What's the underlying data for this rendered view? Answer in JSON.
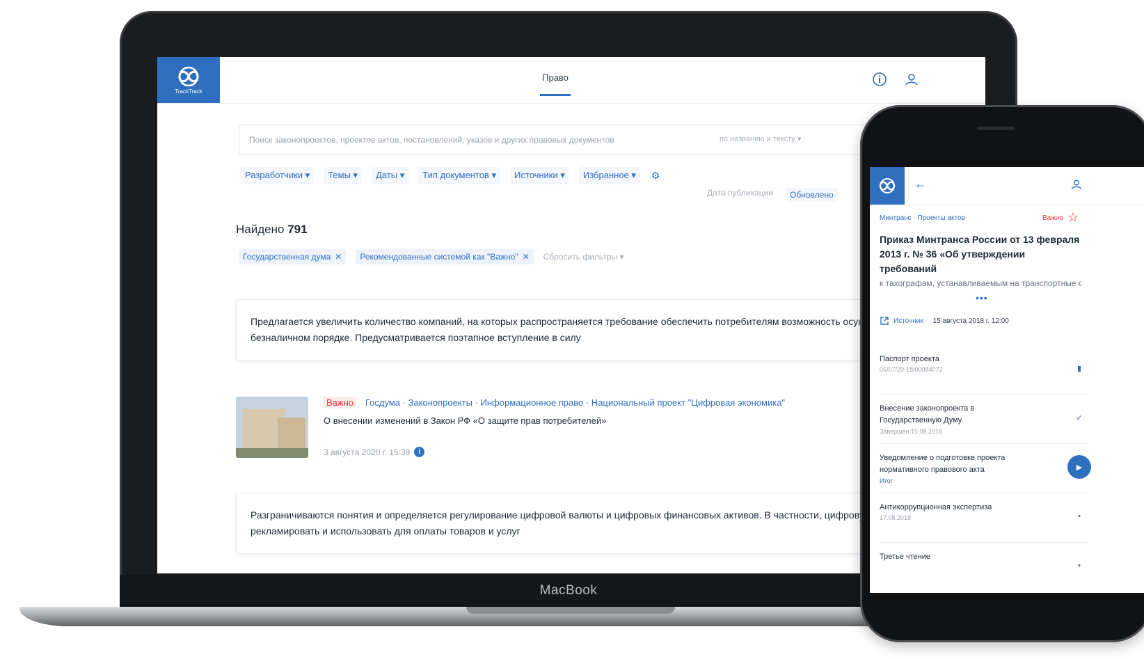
{
  "laptop": {
    "brand": "MacBook"
  },
  "app": {
    "logo_text": "TrackTrack",
    "nav_tab": "Право",
    "search": {
      "placeholder": "Поиск законопроектов, проектов актов, постановлений, указов и других правовых документов",
      "mode": "по названию и тексту ▾"
    },
    "filters": [
      "Разработчики ▾",
      "Темы ▾",
      "Даты ▾",
      "Тип документов ▾",
      "Источники ▾",
      "Избранное ▾"
    ],
    "sort": {
      "label": "Дата публикации",
      "value": "Обновлено"
    },
    "found_label": "Найдено",
    "found_count": "791",
    "tags": [
      "Государственная дума",
      "Рекомендованные системой как \"Важно\""
    ],
    "reset_label": "Сбросить фильтры ▾",
    "cards": [
      {
        "text": "Предлагается увеличить количество компаний, на которых распространяется требование обеспечить потребителям возможность осуществления расчетов в безналичном порядке. Предусматривается поэтапное вступление в силу"
      },
      {
        "text": "Разграничиваются понятия и определяется регулирование цифровой валюты и цифровых финансовых активов. В частности, цифровую валюту запрещается рекламировать и использовать для оплаты товаров и услуг"
      }
    ],
    "item": {
      "badge": "Важно",
      "crumbs": "Госдума · Законопроекты · Информационное право · Национальный проект \"Цифровая экономика\"",
      "title": "О внесении изменений в Закон РФ «О защите прав потребителей»",
      "date": "3 августа 2020 г. 15:39",
      "info": "i"
    }
  },
  "mobile": {
    "crumbs": "Минтранс · Проекты актов",
    "badge": "Важно",
    "title": "Приказ Минтранса России от 13 февраля 2013 г. № 36 «Об утверждении требований",
    "subtitle": "к тахографам, устанавливаемым на транспортные средства, категорий и",
    "more": "•••",
    "source_label": "Источник",
    "date": "15 августа 2018 г. 12:00",
    "steps": [
      {
        "title": "Паспорт проекта",
        "sub": "05/07/20-18/00084072",
        "link": false,
        "icon": "doc"
      },
      {
        "title": "Внесение законопроекта в Государственную Думу",
        "sub": "Завершен 15.08.2018",
        "link": false,
        "icon": "check"
      },
      {
        "title": "Уведомление о подготовке проекта нормативного правового акта",
        "sub": "Итог",
        "link": true,
        "icon": "active"
      },
      {
        "title": "Антикоррупционная экспертиза",
        "sub": "17.08.2018",
        "link": false,
        "icon": "dot"
      },
      {
        "title": "Третье чтение",
        "sub": "",
        "link": false,
        "icon": "dot"
      }
    ]
  },
  "colors": {
    "brand": "#2f6fbf",
    "important": "#e23a3a"
  }
}
